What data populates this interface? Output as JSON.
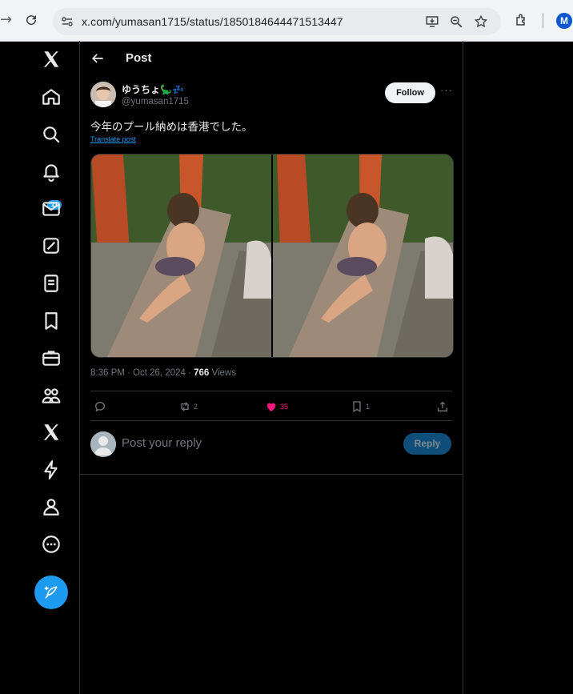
{
  "browser": {
    "url": "x.com/yumasan1715/status/1850184644471513447",
    "profile_initial": "M",
    "icons": [
      "forward-icon",
      "reload-icon",
      "site-settings-icon",
      "install-app-icon",
      "zoom-icon",
      "bookmark-star-icon",
      "extensions-icon",
      "profile-icon"
    ]
  },
  "sidebar": {
    "items": [
      "x-logo-icon",
      "home-icon",
      "explore-icon",
      "notifications-icon",
      "messages-icon",
      "grok-icon",
      "lists-icon",
      "bookmarks-icon",
      "jobs-icon",
      "communities-icon",
      "premium-icon",
      "verified-orgs-icon",
      "profile-icon",
      "more-icon"
    ],
    "notification_count": "11",
    "compose_icon": "compose-post-icon"
  },
  "header": {
    "title": "Post"
  },
  "post": {
    "display_name": "ゆうちょ🦕💤",
    "handle": "@yumasan1715",
    "follow_label": "Follow",
    "more_label": "···",
    "text": "今年のプール納めは香港でした。",
    "translate_label": "Translate post",
    "time": "8:36 PM · Oct 26, 2024 · ",
    "views_count": "766",
    "views_label": " Views",
    "actions": {
      "replies": "",
      "reposts": "2",
      "likes": "35",
      "bookmarks": "1"
    }
  },
  "reply": {
    "placeholder": "Post your reply",
    "button_label": "Reply"
  },
  "colors": {
    "accent": "#1d9bf0",
    "like": "#f91880",
    "background": "#000000",
    "border": "#2f3336",
    "muted": "#71767b"
  }
}
